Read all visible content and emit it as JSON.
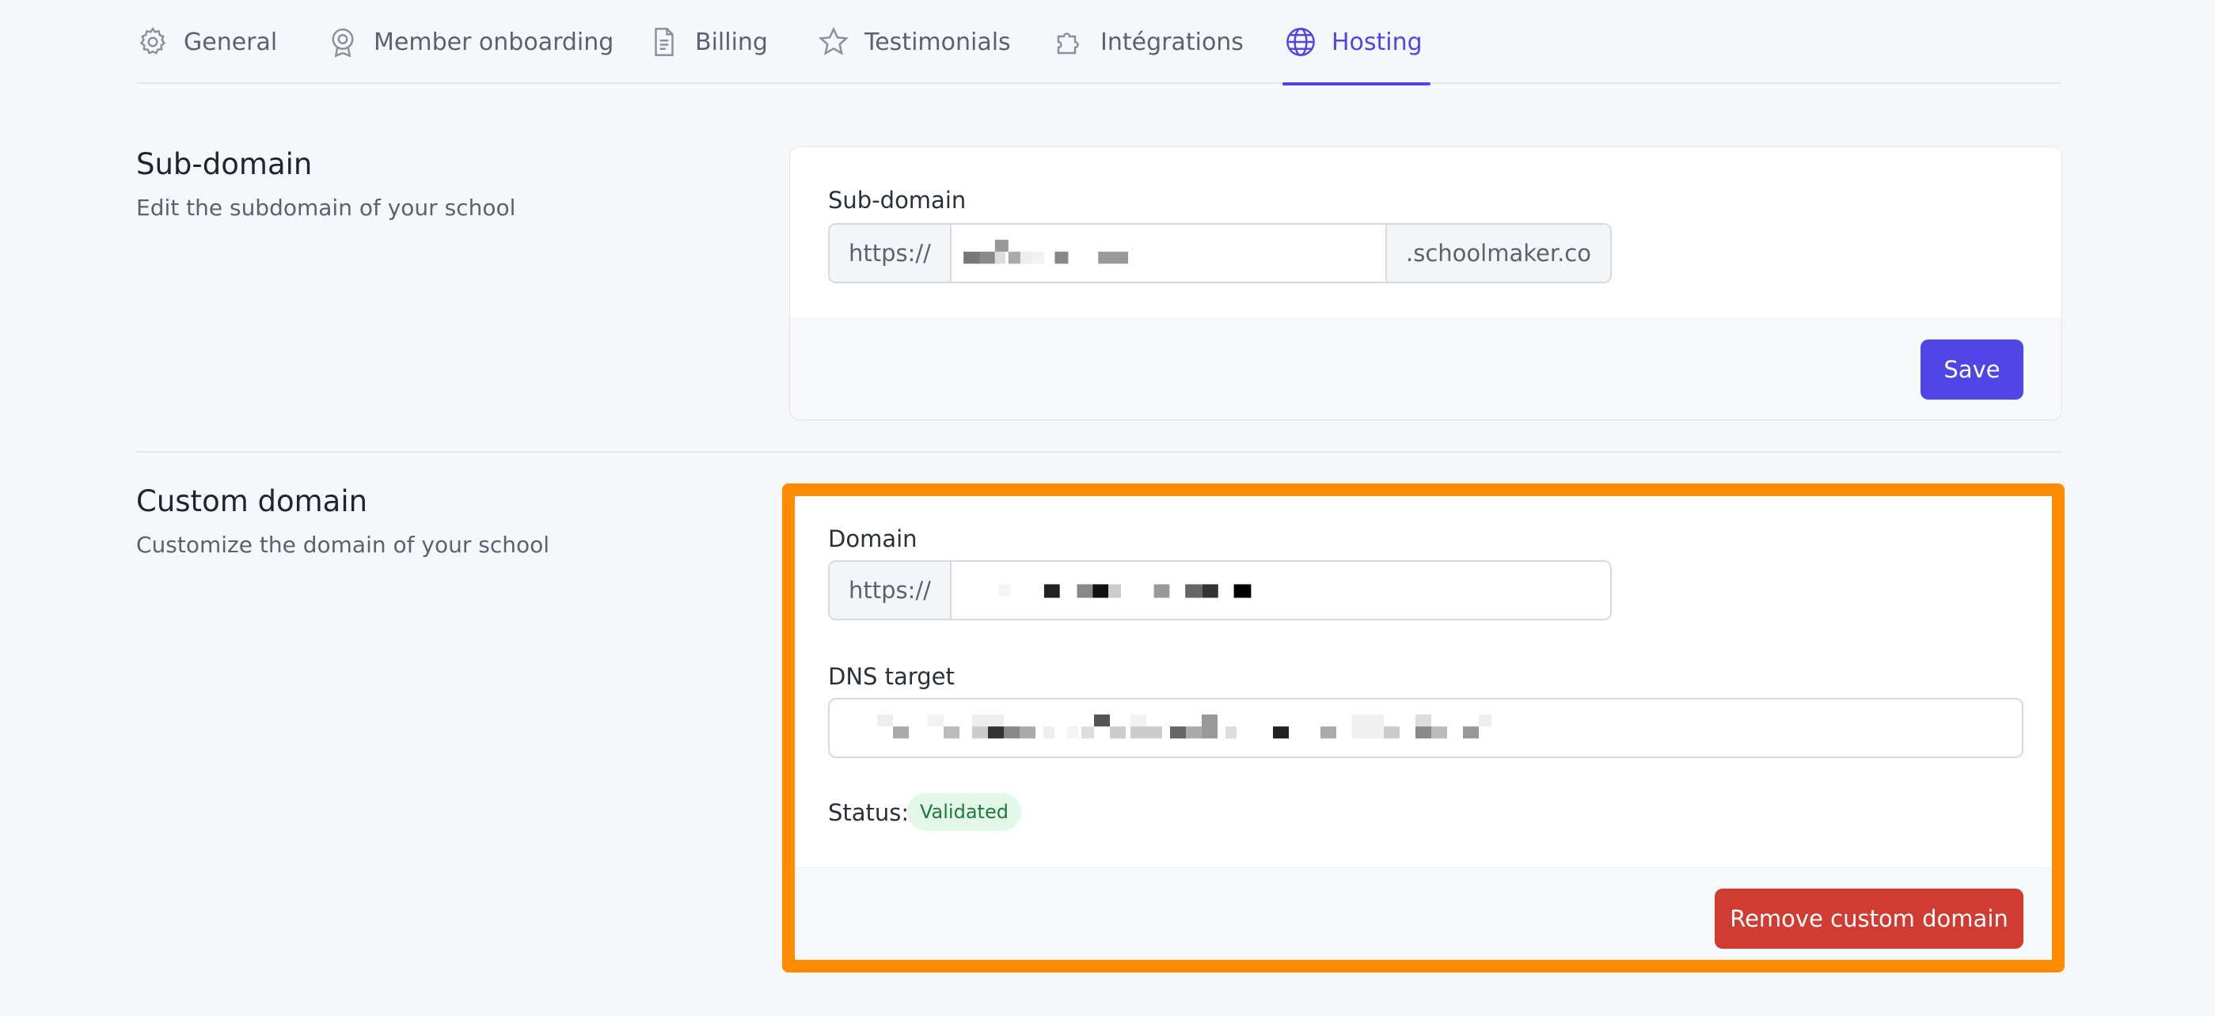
{
  "tabs": [
    {
      "label": "General",
      "icon": "gear-icon"
    },
    {
      "label": "Member onboarding",
      "icon": "badge-icon"
    },
    {
      "label": "Billing",
      "icon": "document-icon"
    },
    {
      "label": "Testimonials",
      "icon": "star-icon"
    },
    {
      "label": "Intégrations",
      "icon": "puzzle-icon"
    },
    {
      "label": "Hosting",
      "icon": "globe-icon",
      "active": true
    }
  ],
  "subdomain": {
    "title": "Sub-domain",
    "description": "Edit the subdomain of your school",
    "field_label": "Sub-domain",
    "prefix": "https://",
    "suffix": ".schoolmaker.co",
    "save_label": "Save"
  },
  "custom_domain": {
    "title": "Custom domain",
    "description": "Customize the domain of your school",
    "domain_label": "Domain",
    "domain_prefix": "https://",
    "dns_label": "DNS target",
    "status_label": "Status:",
    "status_value": "Validated",
    "remove_label": "Remove custom domain"
  },
  "colors": {
    "accent": "#4f46e5",
    "danger": "#d03b32",
    "highlight": "#ff8c00",
    "success_bg": "#e3f7e8",
    "success_text": "#1d7a3e"
  }
}
